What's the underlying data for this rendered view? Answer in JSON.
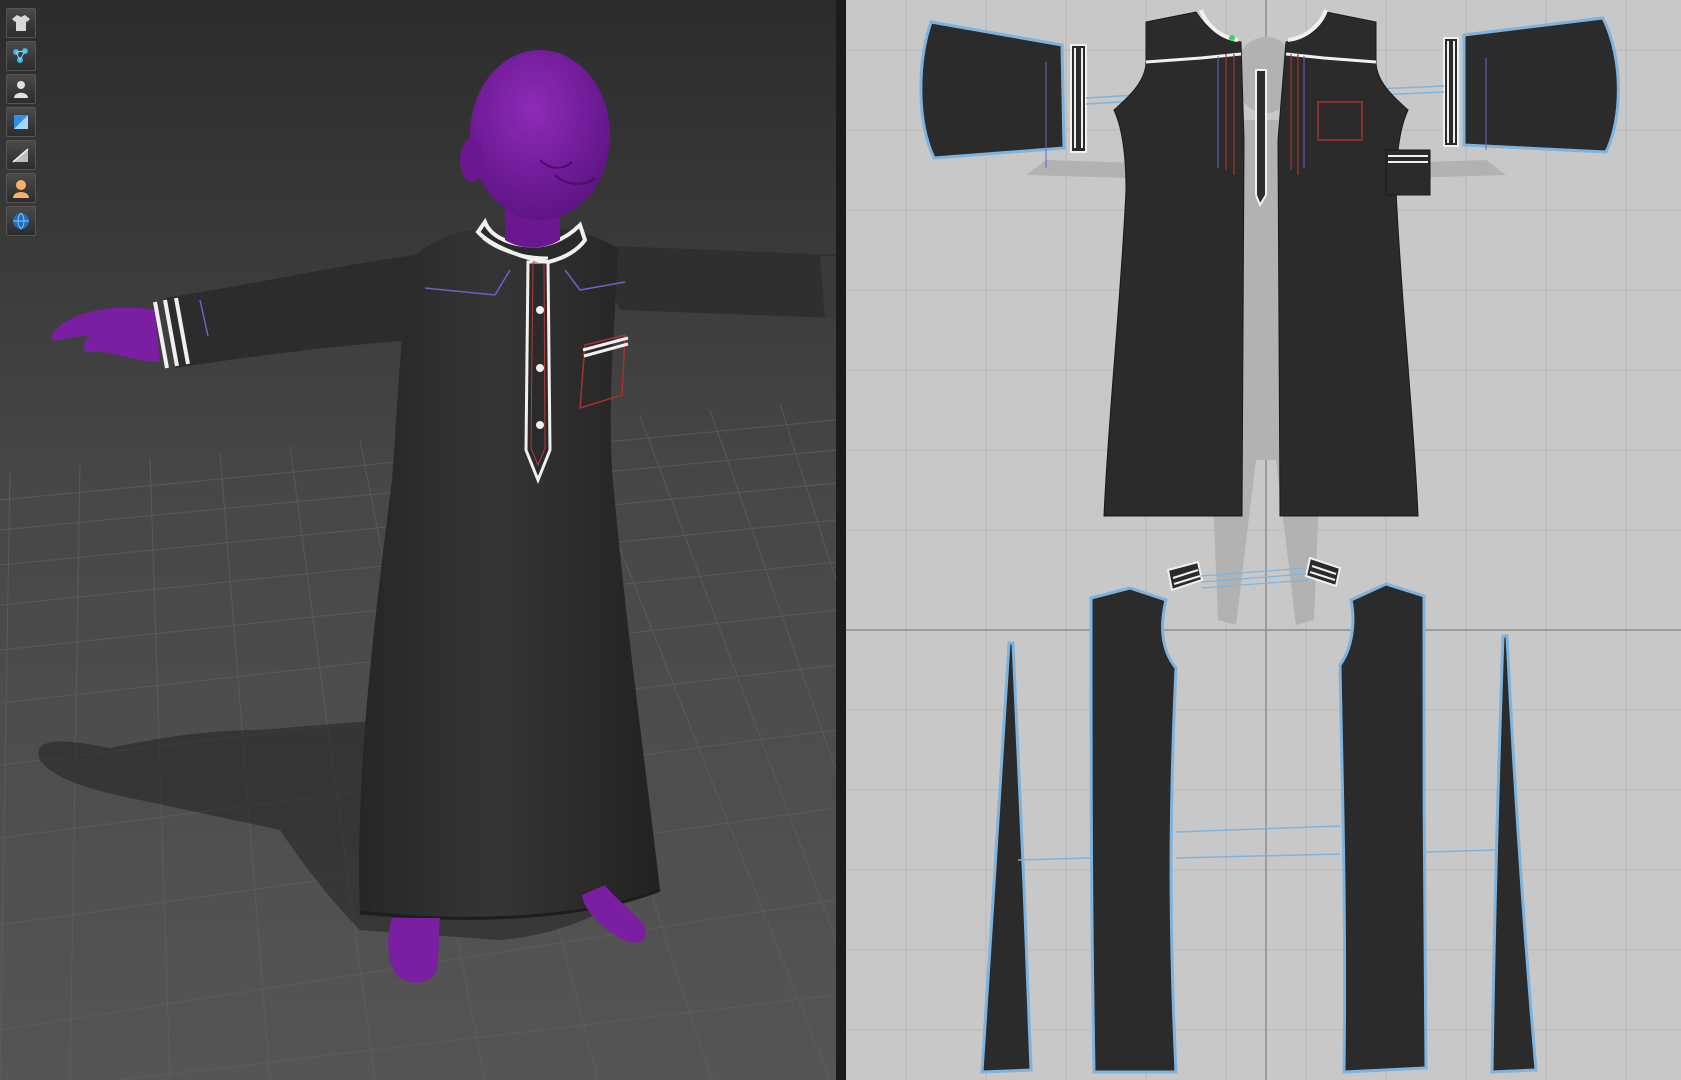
{
  "app": {
    "left_view": "3d-avatar-viewport",
    "right_view": "2d-pattern-window"
  },
  "toolbar": {
    "items": [
      {
        "icon": "garment-icon"
      },
      {
        "icon": "particle-distance-icon"
      },
      {
        "icon": "avatar-icon"
      },
      {
        "icon": "texture-surface-icon"
      },
      {
        "icon": "shading-icon"
      },
      {
        "icon": "avatar-skin-icon"
      },
      {
        "icon": "environment-globe-icon"
      }
    ]
  },
  "colors": {
    "garment": "#2b2b2b",
    "avatar": "#7b1fa2",
    "trim": "#f0f0f0",
    "pattern_outline": "#7eb3dd",
    "pattern_bg": "#c8c8c8",
    "viewport_floor": "#3c3c3c"
  }
}
